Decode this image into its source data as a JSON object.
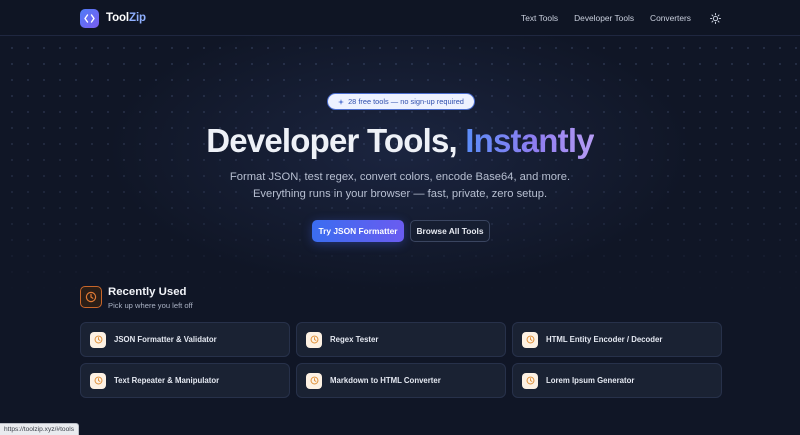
{
  "header": {
    "logo_prefix": "Tool",
    "logo_accent": "Zip",
    "logo_icon": "code-brackets-icon",
    "nav": [
      {
        "label": "Text Tools"
      },
      {
        "label": "Developer Tools"
      },
      {
        "label": "Converters"
      }
    ],
    "theme_toggle_icon": "sun-icon"
  },
  "hero": {
    "badge": "28 free tools — no sign-up required",
    "title_plain": "Developer Tools,",
    "title_accent": "Instantly",
    "subtitle_line1": "Format JSON, test regex, convert colors, encode Base64, and more.",
    "subtitle_line2": "Everything runs in your browser — fast, private, zero setup.",
    "primary_button": "Try JSON Formatter",
    "secondary_button": "Browse All Tools"
  },
  "recently_used": {
    "icon": "clock-icon",
    "title": "Recently Used",
    "subtitle": "Pick up where you left off",
    "items": [
      {
        "label": "JSON Formatter & Validator"
      },
      {
        "label": "Regex Tester"
      },
      {
        "label": "HTML Entity Encoder / Decoder"
      },
      {
        "label": "Text Repeater & Manipulator"
      },
      {
        "label": "Markdown to HTML Converter"
      },
      {
        "label": "Lorem Ipsum Generator"
      }
    ]
  },
  "status_bar": {
    "url": "https://toolzip.xyz/#tools"
  },
  "colors": {
    "background": "#101626",
    "accent_blue": "#3b6df0",
    "accent_purple": "#8f7df0",
    "recent_accent": "#c8662a"
  }
}
